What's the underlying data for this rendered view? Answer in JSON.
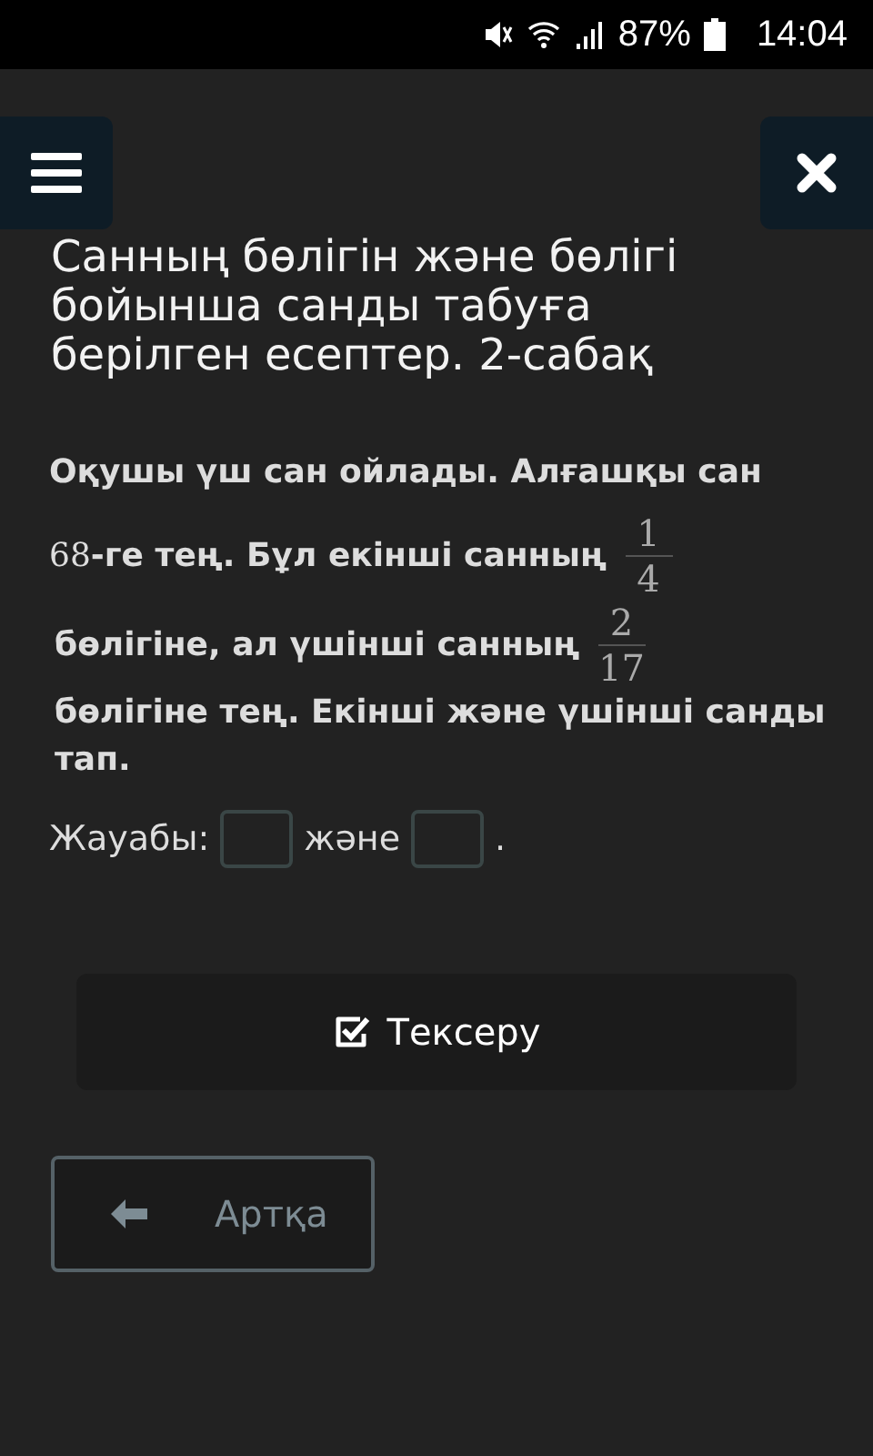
{
  "status_bar": {
    "battery": "87%",
    "time": "14:04"
  },
  "title": "Санның бөлігін және бөлігі бойынша санды табуға берілген есептер. 2-сабақ",
  "problem": [
    {
      "text": "Оқушы үш сан ойлады. Алғашқы сан"
    },
    {
      "number": "68",
      "text": "-ге тең. Бұл екінші санның",
      "fraction": {
        "numerator": "1",
        "denominator": "4"
      }
    },
    {
      "text": "бөлігіне, ал үшінші санның",
      "fraction": {
        "numerator": "2",
        "denominator": "17"
      }
    },
    {
      "text": "бөлігіне тең. Екінші және үшінші санды тап."
    }
  ],
  "answer": {
    "label": "Жауабы:",
    "conjunction": "және",
    "end": "."
  },
  "check_button": {
    "label": "Тексеру"
  },
  "back_button": {
    "label": "Артқа",
    "disabled": true
  }
}
